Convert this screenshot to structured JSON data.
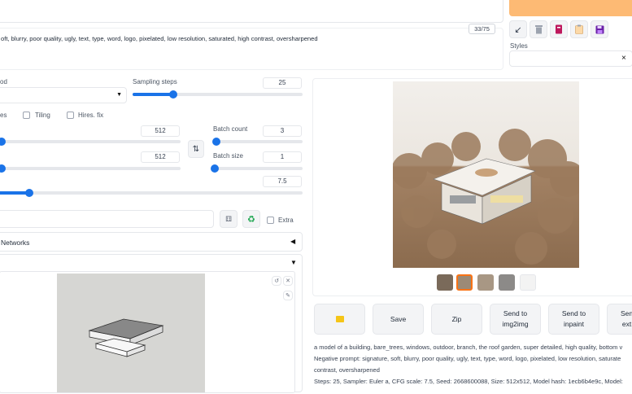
{
  "prompt": {
    "token_counter": "33/75",
    "negative_text": "oft, blurry, poor quality, ugly, text, type, word, logo, pixelated, low resolution, saturated, high contrast, oversharpened"
  },
  "styles": {
    "label": "Styles",
    "clear": "×"
  },
  "settings": {
    "method_label": "od",
    "sampling_steps_label": "Sampling steps",
    "sampling_steps": "25",
    "sampling_steps_frac": 0.24,
    "restore_faces_label": "es",
    "tiling_label": "Tiling",
    "hires_label": "Hires. fix",
    "width": "512",
    "width_frac": 0.05,
    "height": "512",
    "height_frac": 0.05,
    "batch_count_label": "Batch count",
    "batch_count": "3",
    "batch_count_frac": 0.02,
    "batch_size_label": "Batch size",
    "batch_size": "1",
    "batch_size_frac": 0.0,
    "cfg": "7.5",
    "cfg_frac": 0.12,
    "extra_label": "Extra",
    "networks_label": "Networks",
    "networks_arrow": "◀",
    "collapse_arrow": "▼"
  },
  "output": {
    "buttons": {
      "save": "Save",
      "zip": "Zip",
      "img2img": "Send to\nimg2img",
      "inpaint": "Send to\ninpaint",
      "extras": "Sen\next"
    },
    "info_prompt": "a model of a building, bare_trees, windows, outdoor, branch, the roof garden, super detailed, high quality, bottom v",
    "info_negative": "Negative prompt: signature, soft, blurry, poor quality, ugly, text, type, word, logo, pixelated, low resolution, saturate",
    "info_negative2": "contrast, oversharpened",
    "info_params": "Steps: 25, Sampler: Euler a, CFG scale: 7.5, Seed: 2668600088, Size: 512x512, Model hash: 1ecb6b4e9c, Model:"
  },
  "colors": {
    "accent": "#1a73e8",
    "generate": "#fdba74"
  }
}
